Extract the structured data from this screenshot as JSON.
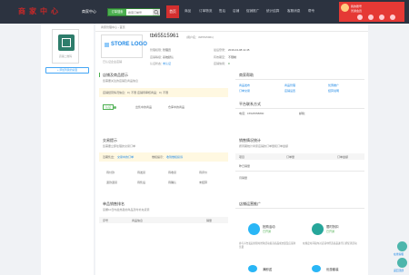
{
  "topbar": {
    "logo": "商家中心",
    "seller_center": "商家中心",
    "search_tag": "订单搜索",
    "search_placeholder": "搜索订单号",
    "nav_home": "首页",
    "nav": [
      "商品",
      "订单物流",
      "售后",
      "店铺",
      "促销推广",
      "统计结算",
      "客服消息",
      "帮专"
    ],
    "user": {
      "name": "我的账号",
      "level": "普通会员"
    }
  },
  "left": {
    "qr_caption": "店铺二维码",
    "share_button": "+ 添加到我的桌面"
  },
  "main": {
    "breadcrumb": "商家管理中心 › 首页",
    "store_logo": "STORE LOGO",
    "store_id": "tb65515961",
    "store_id_suffix": "(用户名：tb65515961)",
    "meta": [
      {
        "label": "管理权限：",
        "value": "管理员"
      },
      {
        "label": "最后登录：",
        "value": "2016-04-08 11:45"
      },
      {
        "label": "店铺等级：",
        "value": "系统默认"
      },
      {
        "label": "有效期至：",
        "value": "不限制"
      },
      {
        "label": "认证状态：",
        "value": "未认证"
      },
      {
        "label": "店铺信用：",
        "value": "0"
      }
    ],
    "store_verify_label": "已认证企业店铺"
  },
  "alerts": {
    "title": "店铺及商品提示",
    "subtitle": "您需要关注的店铺及商品信息",
    "bar": "店铺经营情况信息：0 | 不限    店铺待审核商品：0 | 不限",
    "btn_verify": "认证",
    "links": [
      "出售中的商品",
      "仓库中的商品"
    ]
  },
  "platform": {
    "title": "商家帮助",
    "links": [
      "商品发布",
      "商品管理",
      "优惠推广",
      "订单交易",
      "店铺设置",
      "结算说明"
    ]
  },
  "contact": {
    "title": "平台联系方式",
    "phone": "电话：15526558890",
    "email": "邮箱："
  },
  "trade": {
    "title": "交易提示",
    "subtitle": "您需要立即处理的交易订单",
    "bar_left": "近期售出：",
    "bar_link1": "交易中的订单",
    "bar_mid": "维权提示：",
    "bar_link2": "收到维权投诉",
    "cells": [
      "待付款",
      "待发货",
      "待收货",
      "待评价",
      "退款退货",
      "待售后",
      "待确认",
      "未结算"
    ]
  },
  "sales_stats": {
    "title": "销售情况统计",
    "subtitle": "按周期统计商家店铺的订单量和订单金额",
    "headers": [
      "项目",
      "订单量",
      "订单金额"
    ],
    "rows": [
      {
        "label": "昨日销量",
        "count": "",
        "amount": ""
      },
      {
        "label": "月销量",
        "count": "",
        "amount": ""
      }
    ]
  },
  "ranking": {
    "title": "单品销售排名",
    "subtitle": "掌握10日内最热卖的商品及时补充货源",
    "headers": [
      "序号",
      "商品信息",
      "销量"
    ]
  },
  "promo": {
    "title": "店铺运营推广",
    "items": [
      {
        "name": "抢购活动",
        "status": "已开通",
        "desc": "参与平台发起的限时抢购活动提高商品成交量及店铺浏览量",
        "color": "#29b6f6"
      },
      {
        "name": "限时折扣",
        "status": "已开通",
        "desc": "在规定时间段内对店铺中所选商品进行打折促销活动",
        "color": "#26a69a"
      },
      {
        "name": "满即送",
        "status": "",
        "desc": "",
        "color": "#29b6f6"
      },
      {
        "name": "优惠套装",
        "status": "",
        "desc": "",
        "color": "#29b6f6"
      }
    ]
  },
  "rail": {
    "top_label": "在线客服",
    "bottom_label": "返回顶部"
  }
}
